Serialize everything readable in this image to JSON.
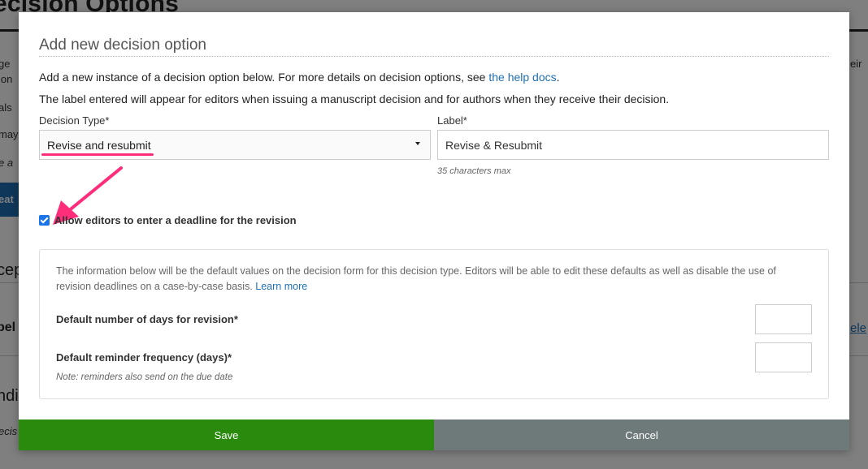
{
  "background": {
    "title": "ecision Options",
    "fragments": [
      "ge",
      "ion",
      "als",
      "may",
      "e a",
      "eir"
    ],
    "button_fragment": "eat",
    "section_fragment_1": "cep",
    "section_fragment_2": "ndi",
    "row_fragment": "bel",
    "row_fragment_2": "ecis",
    "link_fragment": "ele"
  },
  "modal": {
    "title": "Add new decision option",
    "intro_prefix": "Add a new instance of a decision option below. For more details on decision options, see ",
    "intro_link": "the help docs",
    "intro_suffix": ".",
    "intro_line2": "The label entered will appear for editors when issuing a manuscript decision and for authors when they receive their decision.",
    "decision_type": {
      "label": "Decision Type*",
      "selected": "Revise and resubmit"
    },
    "label_field": {
      "label": "Label*",
      "value": "Revise & Resubmit",
      "hint": "35 characters max"
    },
    "deadline_checkbox": {
      "label": "Allow editors to enter a deadline for the revision",
      "checked": true
    },
    "defaults_panel": {
      "description": "The information below will be the default values on the decision form for this decision type. Editors will be able to edit these defaults as well as disable the use of revision deadlines on a case-by-case basis. ",
      "learn_more": "Learn more",
      "days_label": "Default number of days for revision*",
      "days_value": "",
      "reminder_label": "Default reminder frequency (days)*",
      "reminder_value": "",
      "note": "Note: reminders also send on the due date"
    },
    "save_label": "Save",
    "cancel_label": "Cancel"
  },
  "colors": {
    "save": "#2a8a0e",
    "cancel": "#6e7a7a",
    "link": "#1f6fb5",
    "annotation": "#ff2d7a",
    "checkbox": "#1a73e8"
  }
}
